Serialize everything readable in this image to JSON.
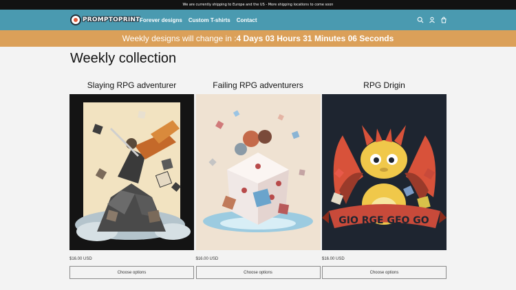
{
  "announcement": "We are currently shipping to Europe and the US - More shipping locations to come soon",
  "header": {
    "logo_text": "PROMPTOPRINT",
    "nav": [
      "Forever designs",
      "Custom T-shirts",
      "Contact"
    ],
    "icons": [
      "search-icon",
      "account-icon",
      "cart-icon"
    ]
  },
  "countdown": {
    "label": "Weekly designs will change in :",
    "time": "4 Days 03 Hours 31 Minutes 06 Seconds"
  },
  "collection": {
    "title": "Weekly collection",
    "products": [
      {
        "title": "Slaying RPG adventurer",
        "price": "$16.00 USD",
        "button": "Choose options"
      },
      {
        "title": "Failing RPG adventurers",
        "price": "$16.00 USD",
        "button": "Choose options"
      },
      {
        "title": "RPG Drigin",
        "price": "$16.00 USD",
        "button": "Choose options",
        "banner_text": "GIO RGE GEO GO"
      }
    ]
  },
  "colors": {
    "header": "#4a9ab0",
    "countdown": "#dba059",
    "background": "#f3f3f3",
    "announcement": "#121212"
  }
}
